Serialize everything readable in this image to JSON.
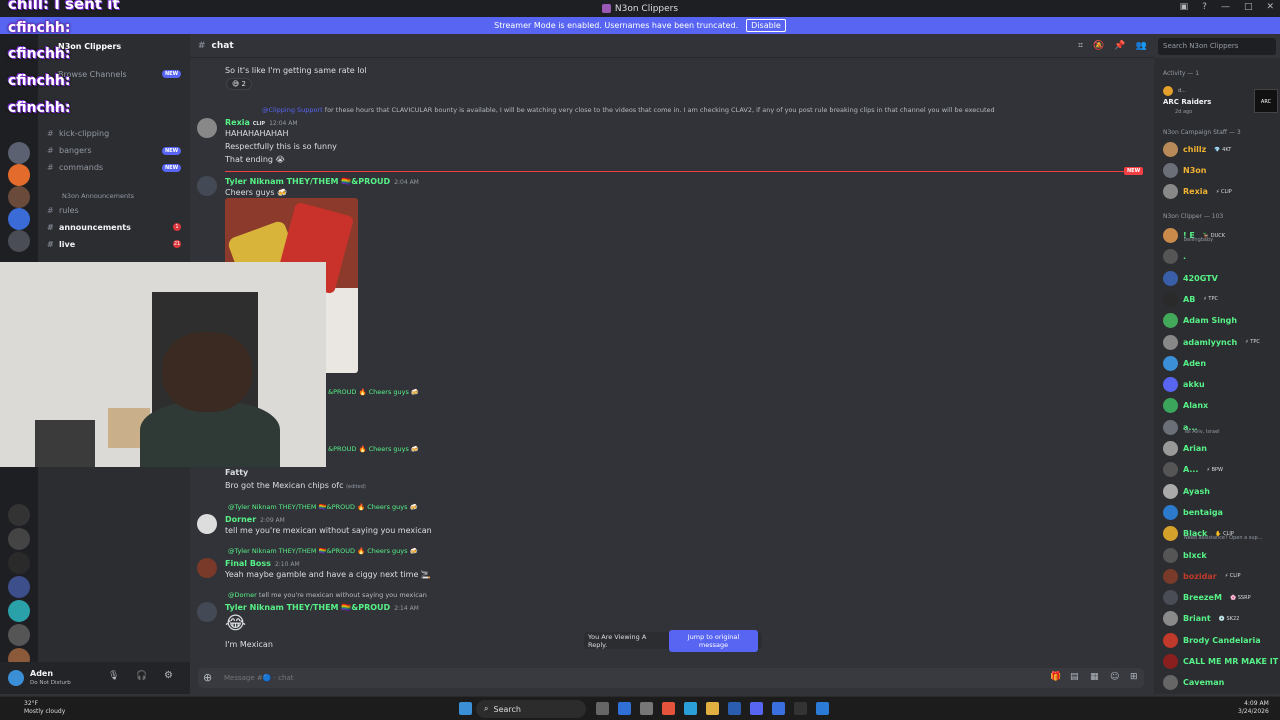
{
  "window": {
    "title": "N3on Clippers"
  },
  "streamer_banner": {
    "text": "Streamer Mode is enabled. Usernames have been truncated.",
    "button": "Disable"
  },
  "overlay": {
    "top": "chill: I sent it",
    "names": [
      "cfinchh:",
      "cfinchh:",
      "cfinchh:",
      "cfinchh:"
    ]
  },
  "server": {
    "name": "N3on Clippers",
    "browse": "Browse Channels"
  },
  "channels": [
    {
      "name": "kick-clipping",
      "badge": ""
    },
    {
      "name": "bangers",
      "badge": "NEW"
    },
    {
      "name": "commands",
      "badge": "NEW"
    },
    {
      "name": "N3on Announcements",
      "badge": ""
    },
    {
      "name": "rules",
      "badge": ""
    },
    {
      "name": "announcements",
      "badge": "1"
    },
    {
      "name": "live",
      "badge": "21"
    }
  ],
  "channel_header": {
    "name": "chat",
    "search_placeholder": "Search N3on Clippers"
  },
  "messages": {
    "m0_text": "So it's like I'm getting same rate lol",
    "m0_reaction": "😅 2",
    "m1_reply_user": "@Clipping Support",
    "m1_reply_text": "for these hours that CLAVICULAR bounty is available, I will be watching very close to the videos that come in. I am checking CLAV2, if any of you post rule breaking clips in that channel you will be executed",
    "m1_user": "Rexia",
    "m1_tag": "CLIP",
    "m1_time": "12:04 AM",
    "m1_l1": "HAHAHAHAHAH",
    "m1_l2": "Respectfully this is so funny",
    "m1_l3": "That ending 😭",
    "new_tag": "NEW",
    "m2_user": "Tyler Niknam THEY/THEM 🏳️‍🌈&PROUD",
    "m2_time": "2:04 AM",
    "m2_text": "Cheers guys 🍻",
    "m3_reply": "&PROUD 🔥 Cheers guys 🍻",
    "m4_reply": "&PROUD 🔥 Cheers guys 🍻",
    "m4_user": "Fatty",
    "m4_text": "Bro got the Mexican chips ofc",
    "m4_edited": "(edited)",
    "m5_reply": "@Tyler Niknam THEY/THEM 🏳️‍🌈&PROUD 🔥 Cheers guys 🍻",
    "m5_user": "Dorner",
    "m5_time": "2:09 AM",
    "m5_text": "tell me you're mexican without saying you mexican",
    "m6_reply": "@Tyler Niknam THEY/THEM 🏳️‍🌈&PROUD 🔥 Cheers guys 🍻",
    "m6_user": "Final Boss",
    "m6_time": "2:10 AM",
    "m6_text": "Yeah maybe gamble and have a ciggy next time 🚬",
    "m7_reply_user": "@Dorner",
    "m7_reply_text": "tell me you're mexican without saying you mexican",
    "m7_user": "Tyler Niknam THEY/THEM 🏳️‍🌈&PROUD",
    "m7_time": "2:14 AM",
    "m7_emoji": "😂",
    "m7_text": "I'm Mexican"
  },
  "reply_banner": {
    "text": "You Are Viewing A Reply.",
    "button": "Jump to original message"
  },
  "composer": {
    "placeholder": "Message #🔵 · chat"
  },
  "user_panel": {
    "name": "Aden",
    "status": "Do Not Disturb"
  },
  "members": {
    "activity": "Activity — 1",
    "activity_name": "ARC Raiders",
    "activity_user": "d...",
    "activity_time": "2d ago",
    "staff_header": "N3on Campaign Staff — 3",
    "staff": [
      {
        "name": "chillz",
        "tag": "💎 4KT",
        "color": "#f0b232"
      },
      {
        "name": "N3on",
        "tag": "",
        "color": "#f0b232"
      },
      {
        "name": "Rexia",
        "tag": "⚡ CLIP",
        "color": "#f0b232"
      }
    ],
    "clipper_header": "N3on Clipper — 103",
    "clippers": [
      {
        "name": "! E",
        "tag": "🦆 DUCK",
        "sub": "bellingbaby",
        "color": "#57f287"
      },
      {
        "name": ".",
        "tag": "",
        "sub": "",
        "color": "#57f287"
      },
      {
        "name": "420GTV",
        "tag": "",
        "sub": "",
        "color": "#57f287"
      },
      {
        "name": "AB",
        "tag": "⚡ TPC",
        "sub": "",
        "color": "#57f287"
      },
      {
        "name": "Adam Singh",
        "tag": "",
        "sub": "",
        "color": "#57f287"
      },
      {
        "name": "adamlyynch",
        "tag": "⚡ TPC",
        "sub": "",
        "color": "#57f287"
      },
      {
        "name": "Aden",
        "tag": "",
        "sub": "",
        "color": "#57f287"
      },
      {
        "name": "akku",
        "tag": "",
        "sub": "",
        "color": "#57f287"
      },
      {
        "name": "Alanx",
        "tag": "",
        "sub": "",
        "color": "#57f287"
      },
      {
        "name": "a...",
        "tag": "",
        "sub": "Tel Aviv, Israel",
        "color": "#57f287"
      },
      {
        "name": "Arian",
        "tag": "",
        "sub": "",
        "color": "#57f287"
      },
      {
        "name": "A...",
        "tag": "⚡ BPW",
        "sub": "",
        "color": "#57f287"
      },
      {
        "name": "Ayash",
        "tag": "",
        "sub": "",
        "color": "#57f287"
      },
      {
        "name": "bentaiga",
        "tag": "",
        "sub": "",
        "color": "#57f287"
      },
      {
        "name": "Black",
        "tag": "✋ CLIP",
        "sub": "Need assistance? Open a sup...",
        "color": "#57f287"
      },
      {
        "name": "blxck",
        "tag": "",
        "sub": "",
        "color": "#57f287"
      },
      {
        "name": "bozidar",
        "tag": "⚡ CLIP",
        "sub": "",
        "color": "#c0392b"
      },
      {
        "name": "BreezeM",
        "tag": "🌸 SSRP",
        "sub": "",
        "color": "#57f287"
      },
      {
        "name": "Briant",
        "tag": "💿 SK22",
        "sub": "",
        "color": "#57f287"
      },
      {
        "name": "Brody Candelaria",
        "tag": "",
        "sub": "",
        "color": "#57f287"
      },
      {
        "name": "CALL ME MR MAKE IT H...",
        "tag": "",
        "sub": "",
        "color": "#57f287"
      },
      {
        "name": "Caveman",
        "tag": "",
        "sub": "",
        "color": "#57f287"
      }
    ]
  },
  "taskbar": {
    "search": "Search",
    "weather_temp": "32°F",
    "weather_desc": "Mostly cloudy",
    "time": "4:09 AM",
    "date": "3/24/2026"
  },
  "colors": {
    "accent": "#5865f2",
    "tyler": "#57f287",
    "rexia": "#57f287"
  }
}
